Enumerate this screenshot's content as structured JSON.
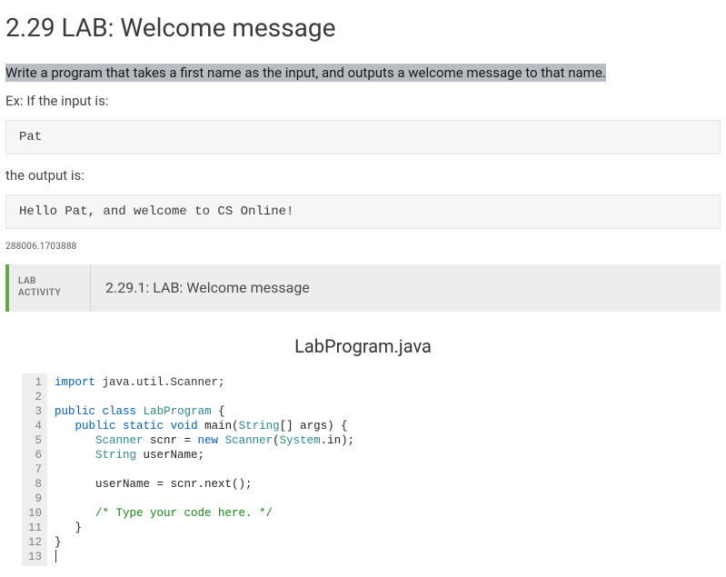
{
  "title": "2.29 LAB: Welcome message",
  "instructions_highlight": "Write a program that takes a first name as the input, and outputs a welcome message to that name.",
  "example_label": "Ex: If the input is:",
  "example_input": "Pat",
  "output_label": "the output is:",
  "example_output": "Hello Pat, and welcome to CS Online!",
  "session_id": "288006.1703888",
  "lab_bar": {
    "label_line1": "LAB",
    "label_line2": "ACTIVITY",
    "title": "2.29.1: LAB: Welcome message"
  },
  "file_name": "LabProgram.java",
  "code_lines": [
    {
      "n": 1,
      "tokens": [
        [
          "kw",
          "import"
        ],
        [
          "pkg",
          " java.util.Scanner;"
        ]
      ]
    },
    {
      "n": 2,
      "tokens": [
        [
          "",
          ""
        ]
      ]
    },
    {
      "n": 3,
      "tokens": [
        [
          "kw",
          "public"
        ],
        [
          "",
          " "
        ],
        [
          "kw",
          "class"
        ],
        [
          "",
          " "
        ],
        [
          "cls",
          "LabProgram"
        ],
        [
          "",
          " {"
        ]
      ]
    },
    {
      "n": 4,
      "tokens": [
        [
          "",
          "   "
        ],
        [
          "kw",
          "public"
        ],
        [
          "",
          " "
        ],
        [
          "kw",
          "static"
        ],
        [
          "",
          " "
        ],
        [
          "typ",
          "void"
        ],
        [
          "",
          " main("
        ],
        [
          "cls",
          "String"
        ],
        [
          "",
          "[] args) {"
        ]
      ]
    },
    {
      "n": 5,
      "tokens": [
        [
          "",
          "      "
        ],
        [
          "cls",
          "Scanner"
        ],
        [
          "",
          " scnr = "
        ],
        [
          "kw",
          "new"
        ],
        [
          "",
          " "
        ],
        [
          "cls",
          "Scanner"
        ],
        [
          "",
          "("
        ],
        [
          "sys",
          "System"
        ],
        [
          "",
          ".in);"
        ]
      ]
    },
    {
      "n": 6,
      "tokens": [
        [
          "",
          "      "
        ],
        [
          "cls",
          "String"
        ],
        [
          "",
          " userName;"
        ]
      ]
    },
    {
      "n": 7,
      "tokens": [
        [
          "",
          ""
        ]
      ]
    },
    {
      "n": 8,
      "tokens": [
        [
          "",
          "      userName = scnr.next();"
        ]
      ]
    },
    {
      "n": 9,
      "tokens": [
        [
          "",
          ""
        ]
      ]
    },
    {
      "n": 10,
      "tokens": [
        [
          "",
          "      "
        ],
        [
          "cmt",
          "/* Type your code here. */"
        ]
      ]
    },
    {
      "n": 11,
      "tokens": [
        [
          "",
          "   }"
        ]
      ]
    },
    {
      "n": 12,
      "tokens": [
        [
          "",
          "}"
        ]
      ]
    },
    {
      "n": 13,
      "tokens": [
        [
          "",
          ""
        ]
      ],
      "cursor": true
    }
  ]
}
